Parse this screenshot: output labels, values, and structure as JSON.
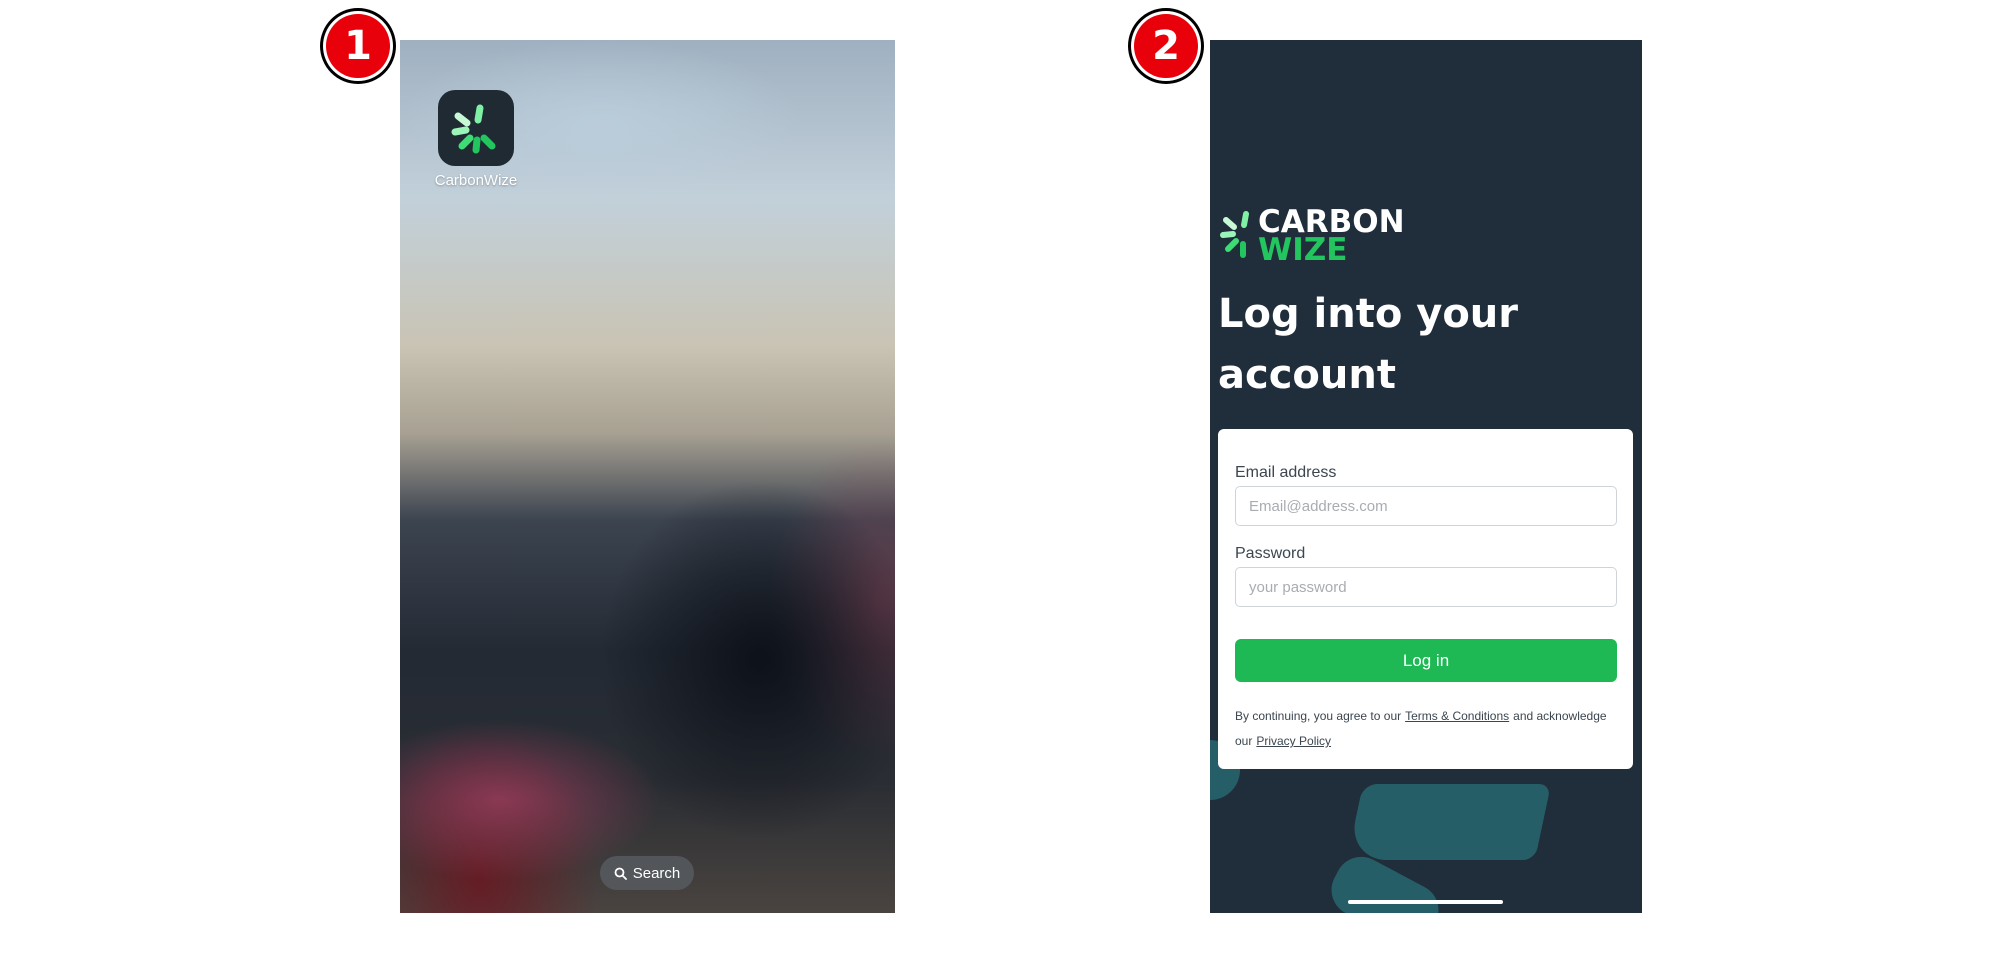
{
  "steps": [
    {
      "number": "1"
    },
    {
      "number": "2"
    }
  ],
  "home_screen": {
    "app_icon": "carbonwize-app-icon",
    "app_label": "CarbonWize",
    "search_label": "Search",
    "search_icon": "search-icon"
  },
  "login_screen": {
    "logo": {
      "line1": "CARBON",
      "line2": "WIZE"
    },
    "heading": "Log into your account",
    "email": {
      "label": "Email address",
      "placeholder": "Email@address.com",
      "value": ""
    },
    "password": {
      "label": "Password",
      "placeholder": "your password",
      "value": ""
    },
    "login_button": "Log in",
    "legal": {
      "prefix": "By continuing, you agree to our",
      "terms_link": "Terms & Conditions",
      "middle": "and acknowledge our",
      "privacy_link": "Privacy Policy"
    }
  },
  "colors": {
    "badge_red": "#e8000b",
    "brand_green": "#22c55e",
    "button_green": "#1eb954",
    "login_bg": "#202d3b",
    "decor_teal": "#265e67"
  }
}
